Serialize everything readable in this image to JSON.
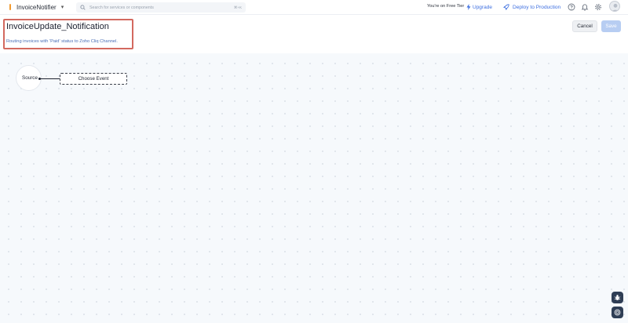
{
  "topbar": {
    "project_name": "InvoiceNotifier",
    "search_placeholder": "Search for services or components",
    "search_shortcut": "⌘+K",
    "tier_text": "You're on Free Tier",
    "upgrade_label": "Upgrade",
    "deploy_label": "Deploy to Production"
  },
  "header": {
    "title": "InvoiceUpdate_Notification",
    "description": "Routing invoices with 'Paid' status to Zoho Cliq Channel.",
    "cancel_label": "Cancel",
    "save_label": "Save"
  },
  "canvas": {
    "source_label": "Source",
    "event_label": "Choose Event"
  },
  "colors": {
    "accent": "#3d6fe0",
    "highlight_border": "#d3695f",
    "save_disabled": "#b7cdf2",
    "canvas_bg": "#f6f9fc"
  },
  "icons": {
    "search": "search-icon",
    "upgrade": "bolt-icon",
    "deploy": "rocket-icon",
    "help": "help-icon",
    "notifications": "bell-icon",
    "settings": "gear-icon",
    "avatar": "user-avatar",
    "bug": "bug-icon",
    "support": "support-icon"
  }
}
